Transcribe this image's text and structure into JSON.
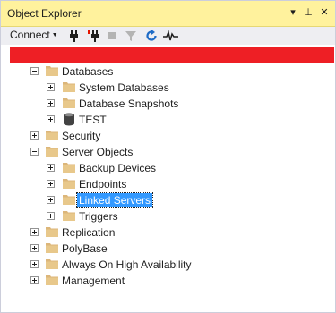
{
  "window": {
    "title": "Object Explorer"
  },
  "title_buttons": {
    "dropdown": "▾",
    "pin": "⊥",
    "close": "✕"
  },
  "toolbar": {
    "connect_label": "Connect",
    "icons": [
      "connect-plug-icon",
      "disconnect-plug-icon",
      "stop-icon",
      "filter-icon",
      "refresh-icon",
      "activity-monitor-icon"
    ]
  },
  "tree": {
    "databases": "Databases",
    "system_databases": "System Databases",
    "database_snapshots": "Database Snapshots",
    "test": "TEST",
    "security": "Security",
    "server_objects": "Server Objects",
    "backup_devices": "Backup Devices",
    "endpoints": "Endpoints",
    "linked_servers": "Linked Servers",
    "triggers": "Triggers",
    "replication": "Replication",
    "polybase": "PolyBase",
    "always_on": "Always On High Availability",
    "management": "Management"
  },
  "colors": {
    "title_bar": "#fff29d",
    "toolbar": "#eeeef2",
    "redaction": "#ee1f25",
    "selection": "#3399ff",
    "folder": "#dcb67a"
  }
}
